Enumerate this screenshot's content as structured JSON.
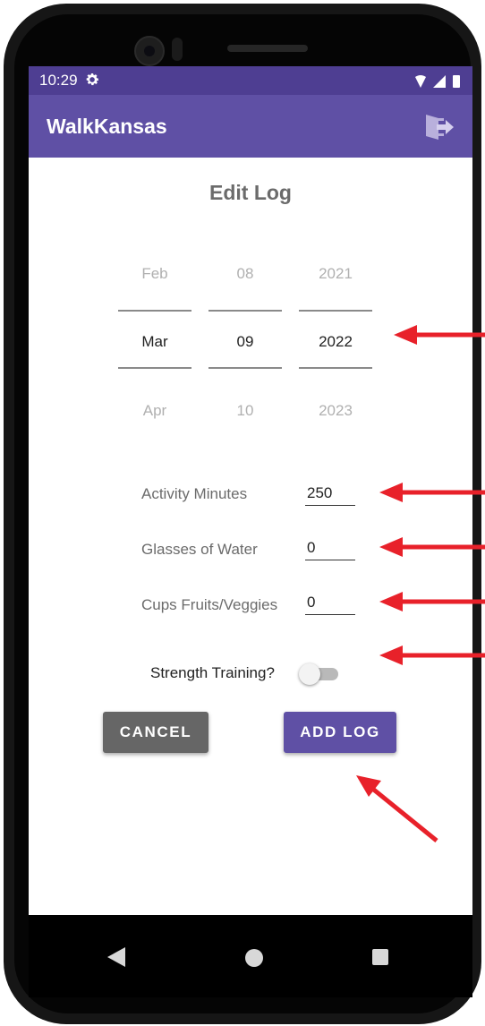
{
  "status_bar": {
    "time": "10:29"
  },
  "app_bar": {
    "title": "WalkKansas"
  },
  "page": {
    "title": "Edit Log"
  },
  "date_picker": {
    "month": {
      "prev": "Feb",
      "selected": "Mar",
      "next": "Apr"
    },
    "day": {
      "prev": "08",
      "selected": "09",
      "next": "10"
    },
    "year": {
      "prev": "2021",
      "selected": "2022",
      "next": "2023"
    }
  },
  "form": {
    "activity_minutes": {
      "label": "Activity Minutes",
      "value": "250"
    },
    "glasses_water": {
      "label": "Glasses of Water",
      "value": "0"
    },
    "cups_fruits": {
      "label": "Cups Fruits/Veggies",
      "value": "0"
    },
    "strength_training": {
      "label": "Strength Training?",
      "checked": false
    }
  },
  "buttons": {
    "cancel": "CANCEL",
    "add_log": "ADD LOG"
  },
  "colors": {
    "primary": "#5f50a5",
    "status_bar": "#4e3e92",
    "cancel_button": "#666666",
    "annotation_arrow": "#e8212a"
  },
  "icons": {
    "status_settings": "gear-icon",
    "status_wifi": "wifi-icon",
    "status_signal": "signal-icon",
    "status_battery": "battery-icon",
    "app_bar_action": "logout-icon",
    "nav_back": "back-triangle-icon",
    "nav_home": "home-circle-icon",
    "nav_recent": "recent-apps-square-icon"
  }
}
